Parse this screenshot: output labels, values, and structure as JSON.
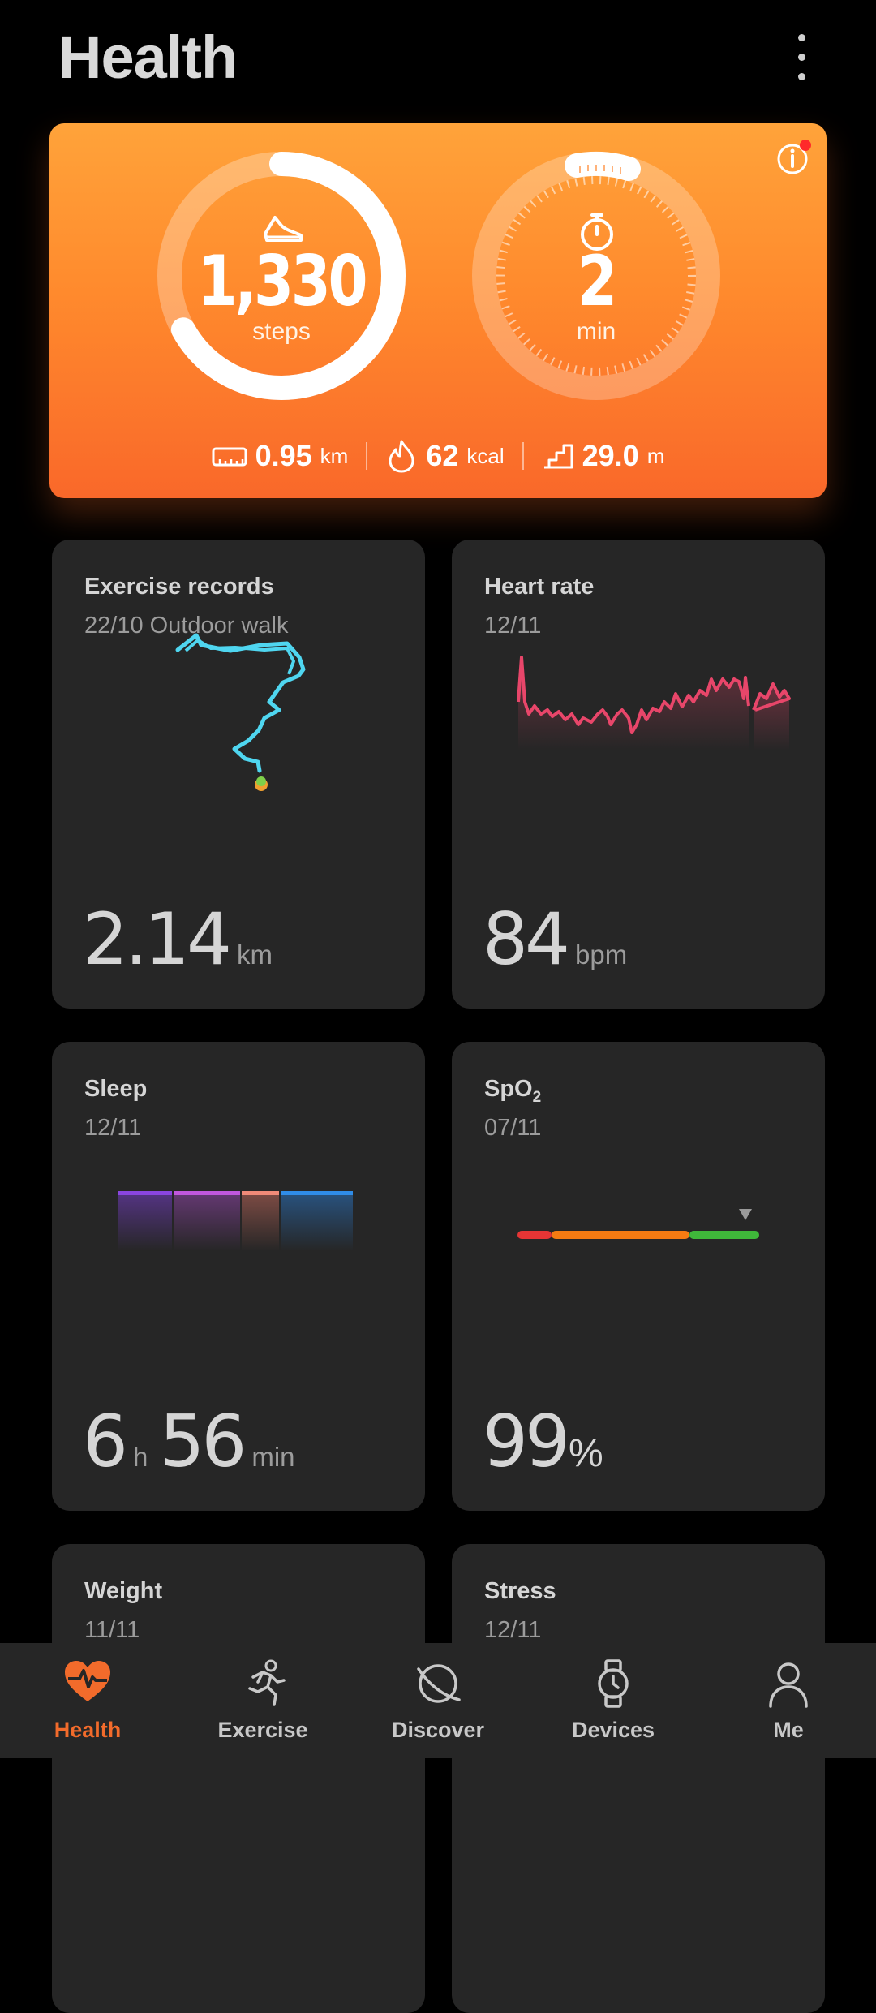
{
  "header": {
    "title": "Health"
  },
  "activity": {
    "steps_value": "1,330",
    "steps_unit": "steps",
    "steps_progress": 0.67,
    "time_value": "2",
    "time_unit": "min",
    "distance_value": "0.95",
    "distance_unit": "km",
    "calories_value": "62",
    "calories_unit": "kcal",
    "climb_value": "29.0",
    "climb_unit": "m"
  },
  "cards": {
    "exercise": {
      "title": "Exercise records",
      "subtitle": "22/10 Outdoor walk",
      "value": "2.14",
      "unit": "km"
    },
    "heart": {
      "title": "Heart rate",
      "subtitle": "12/11",
      "value": "84",
      "unit": "bpm"
    },
    "sleep": {
      "title": "Sleep",
      "subtitle": "12/11",
      "hours": "6",
      "h_unit": "h",
      "minutes": "56",
      "min_unit": "min"
    },
    "spo2": {
      "title_main": "SpO",
      "title_sub": "2",
      "subtitle": "07/11",
      "value": "99",
      "unit": "%"
    },
    "weight": {
      "title": "Weight",
      "subtitle": "11/11"
    },
    "stress": {
      "title": "Stress",
      "subtitle": "12/11"
    }
  },
  "nav": {
    "health": "Health",
    "exercise": "Exercise",
    "discover": "Discover",
    "devices": "Devices",
    "me": "Me"
  },
  "colors": {
    "accent": "#f26b2b",
    "route": "#4fd6f0",
    "heart": "#e8466a"
  }
}
